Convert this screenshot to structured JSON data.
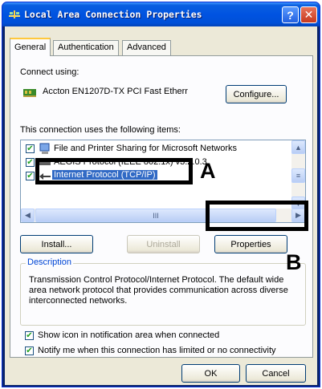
{
  "window": {
    "title": "Local Area Connection Properties",
    "help_label": "?",
    "close_label": "✕"
  },
  "tabs": [
    {
      "label": "General",
      "active": true
    },
    {
      "label": "Authentication",
      "active": false
    },
    {
      "label": "Advanced",
      "active": false
    }
  ],
  "connect_using": {
    "label": "Connect using:",
    "device": "Accton EN1207D-TX PCI Fast Etherr",
    "configure_label": "Configure..."
  },
  "items_section": {
    "label": "This connection uses the following items:",
    "items": [
      {
        "label": "File and Printer Sharing for Microsoft Networks",
        "checked": true,
        "icon": "network-service-icon"
      },
      {
        "label": "AEGIS Protocol (IEEE 802.1x) v3.2.0.3",
        "checked": true,
        "icon": "protocol-icon"
      },
      {
        "label": "Internet Protocol (TCP/IP)",
        "checked": true,
        "icon": "protocol-icon",
        "selected": true
      }
    ],
    "hscroll_thumb": "III"
  },
  "buttons": {
    "install": "Install...",
    "uninstall": "Uninstall",
    "properties": "Properties",
    "ok": "OK",
    "cancel": "Cancel"
  },
  "description": {
    "legend": "Description",
    "text": "Transmission Control Protocol/Internet Protocol. The default wide area network protocol that provides communication across diverse interconnected networks."
  },
  "options": [
    {
      "label": "Show icon in notification area when connected",
      "checked": true
    },
    {
      "label": "Notify me when this connection has limited or no connectivity",
      "checked": true
    }
  ],
  "annotations": {
    "a": "A",
    "b": "B"
  },
  "colors": {
    "titlebar": "#0053e1",
    "selection": "#316ac5",
    "callout": "#000000",
    "legend_text": "#0046d5"
  }
}
